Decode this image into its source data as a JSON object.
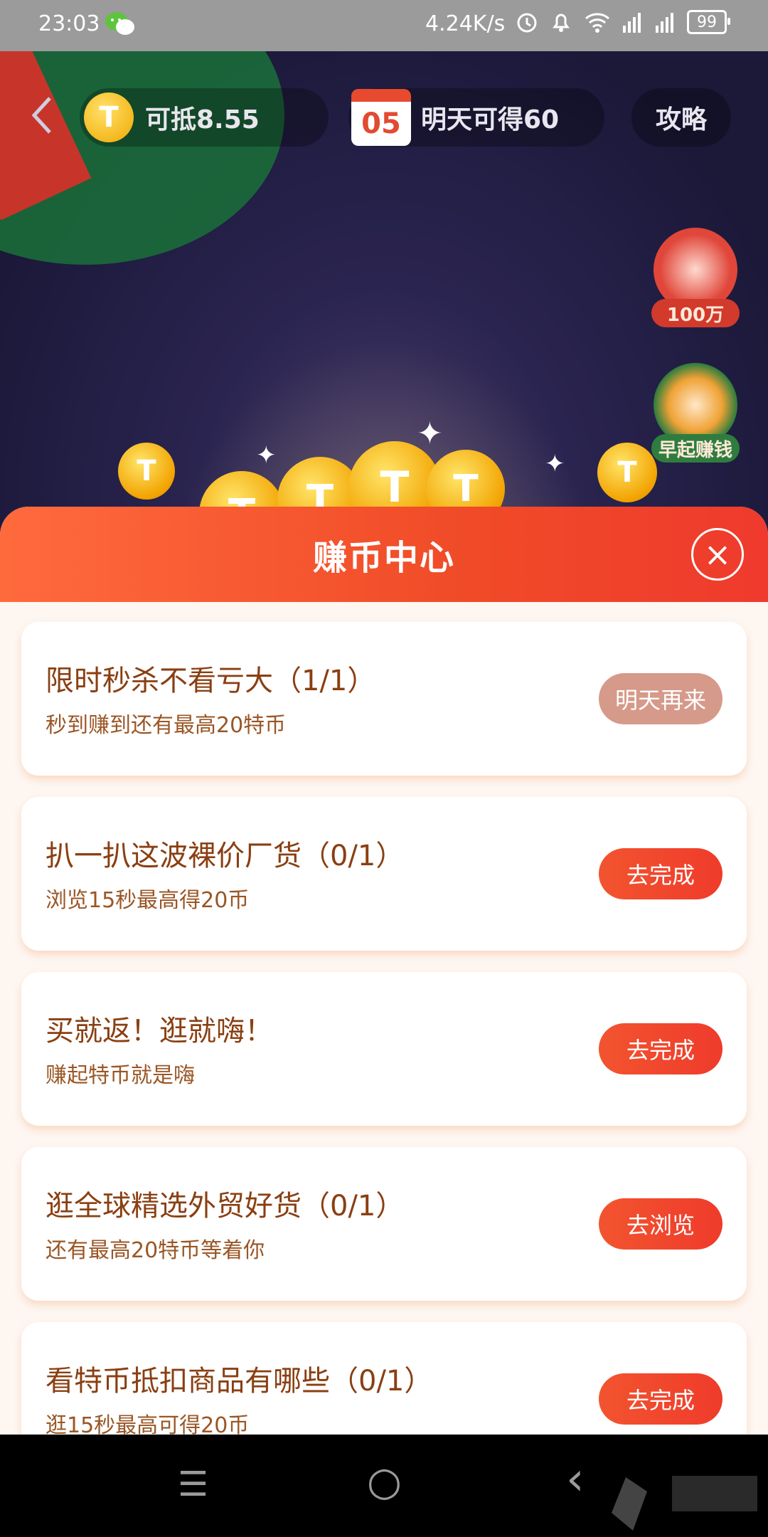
{
  "status_bar": {
    "time": "23:03",
    "speed": "4.24K/s",
    "battery": "99",
    "icons": [
      "wechat-icon",
      "alarm-icon",
      "bell-icon",
      "wifi-icon",
      "signal-icon",
      "signal-4g-icon",
      "battery-icon"
    ]
  },
  "header": {
    "coin_text": "可抵8.55",
    "coin_icon_letter": "T",
    "calendar_day": "05",
    "calendar_text": "明天可得60",
    "guide_label": "攻略"
  },
  "side_buttons": {
    "cards_label": "100万",
    "alarm_label": "早起赚钱"
  },
  "sheet": {
    "title": "赚币中心",
    "tasks": [
      {
        "title": "限时秒杀不看亏大（1/1）",
        "subtitle": "秒到赚到还有最高20特币",
        "button": "明天再来",
        "state": "done"
      },
      {
        "title": "扒一扒这波裸价厂货（0/1）",
        "subtitle": "浏览15秒最高得20币",
        "button": "去完成",
        "state": "go"
      },
      {
        "title": "买就返！逛就嗨！",
        "subtitle": "赚起特币就是嗨",
        "button": "去完成",
        "state": "go"
      },
      {
        "title": "逛全球精选外贸好货（0/1）",
        "subtitle": "还有最高20特币等着你",
        "button": "去浏览",
        "state": "go"
      },
      {
        "title": "看特币抵扣商品有哪些（0/1）",
        "subtitle": "逛15秒最高可得20币",
        "button": "去完成",
        "state": "go"
      }
    ]
  },
  "colors": {
    "accent": "#ef3b2b",
    "text_dark": "#8a3f12",
    "done_button": "#d59a8a"
  },
  "nav": {
    "menu_icon": "☰",
    "home_icon": "○",
    "back_icon": "‹"
  }
}
